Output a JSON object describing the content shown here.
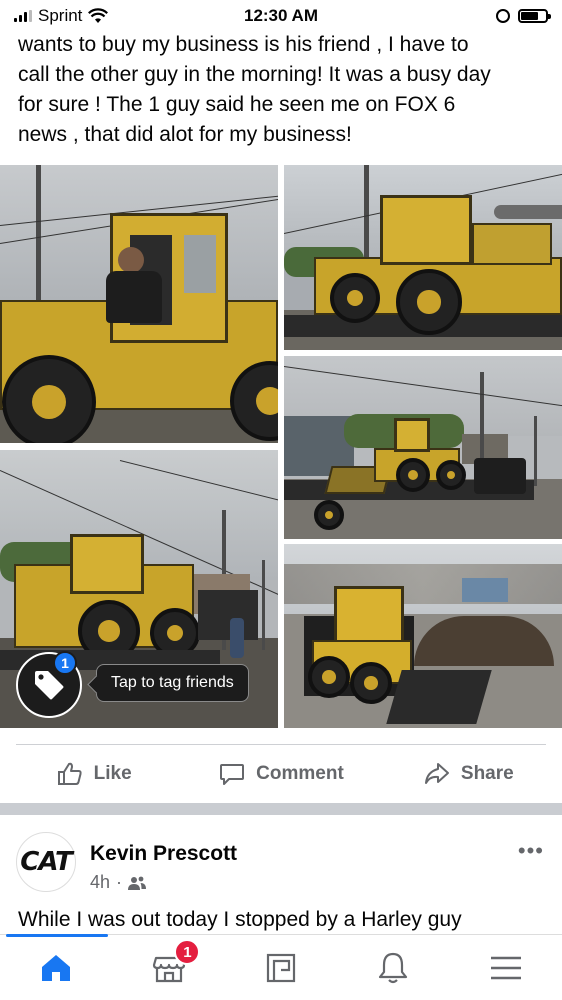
{
  "status_bar": {
    "carrier": "Sprint",
    "time": "12:30 AM"
  },
  "post": {
    "text_lines": [
      "wants to buy my business is his friend , I have to",
      "call the other guy in the morning! It was a busy day",
      "for sure ! The 1 guy said he seen me on FOX 6",
      "news , that did alot for my business!"
    ],
    "tag_badge_count": "1",
    "tag_tooltip": "Tap to tag friends",
    "actions": {
      "like": "Like",
      "comment": "Comment",
      "share": "Share"
    }
  },
  "next_post": {
    "author": "Kevin Prescott",
    "avatar_logo": "CAT",
    "time": "4h",
    "audience_icon": "friends-icon",
    "text": "While I was out today I stopped by a Harley guy"
  },
  "bottom_nav": {
    "items": [
      {
        "icon": "home-icon",
        "active": true
      },
      {
        "icon": "marketplace-icon",
        "badge": "1"
      },
      {
        "icon": "pages-icon"
      },
      {
        "icon": "bell-icon"
      },
      {
        "icon": "menu-icon"
      }
    ]
  },
  "colors": {
    "accent": "#1877f2",
    "badge_red": "#e41e3f",
    "secondary_text": "#65676b",
    "machine_yellow": "#c8a42a"
  }
}
